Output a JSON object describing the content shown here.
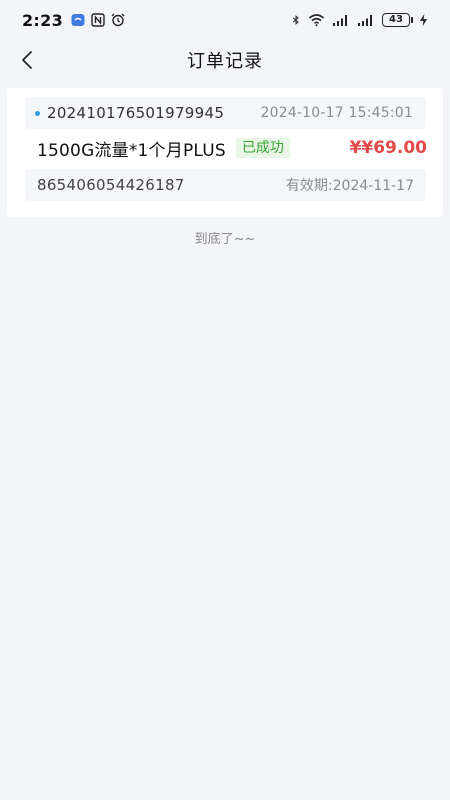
{
  "status_bar": {
    "time": "2:23",
    "battery": "43",
    "icons": [
      "chat-app-icon",
      "nfc-icon",
      "alarm-icon",
      "bluetooth-icon",
      "wifi-icon",
      "signal-icon",
      "signal-icon",
      "charging-icon"
    ]
  },
  "header": {
    "title": "订单记录",
    "back_icon": "chevron-left-icon"
  },
  "orders": [
    {
      "order_id": "20241017650197​9945",
      "order_time": "2024-10-17 15:45:01",
      "product": "1500G流量*1个月PLUS",
      "status": "已成功",
      "price": "¥¥69.00",
      "number": "865406054426187",
      "expiry": "有效期:2024-11-17"
    }
  ],
  "footer": {
    "end_text": "到底了~~"
  },
  "colors": {
    "accent_dot": "#2b9be3",
    "price": "#e44a4a",
    "success": "#3aa534",
    "background": "#f4f5f9"
  }
}
